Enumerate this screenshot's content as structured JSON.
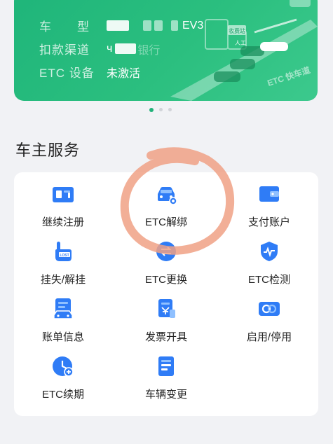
{
  "vehicle_card": {
    "type_label": "车　　型",
    "type_value_suffix": "EV3",
    "channel_label": "扣款渠道",
    "channel_value_prefix": "ч",
    "channel_value_suffix": "银行",
    "device_label": "ETC 设备",
    "device_value": "未激活",
    "scene_signs": [
      "收费站",
      "人工"
    ],
    "scene_lane": "ETC 快车道"
  },
  "carousel": {
    "count": 3,
    "active": 0
  },
  "section": {
    "title": "车主服务"
  },
  "services": [
    {
      "label": "继续注册",
      "icon": "register-card-icon"
    },
    {
      "label": "ETC解绑",
      "icon": "car-unbind-icon"
    },
    {
      "label": "支付账户",
      "icon": "wallet-icon"
    },
    {
      "label": "挂失/解挂",
      "icon": "hand-lost-icon"
    },
    {
      "label": "ETC更换",
      "icon": "swap-icon"
    },
    {
      "label": "ETC检测",
      "icon": "shield-pulse-icon"
    },
    {
      "label": "账单信息",
      "icon": "bill-car-icon"
    },
    {
      "label": "发票开具",
      "icon": "invoice-icon"
    },
    {
      "label": "启用/停用",
      "icon": "toggle-link-icon"
    },
    {
      "label": "ETC续期",
      "icon": "renew-clock-icon"
    },
    {
      "label": "车辆变更",
      "icon": "vehicle-doc-icon"
    }
  ],
  "colors": {
    "banner": "#22b77c",
    "icon_blue": "#2f7cf6",
    "annotation": "#f0a185"
  }
}
